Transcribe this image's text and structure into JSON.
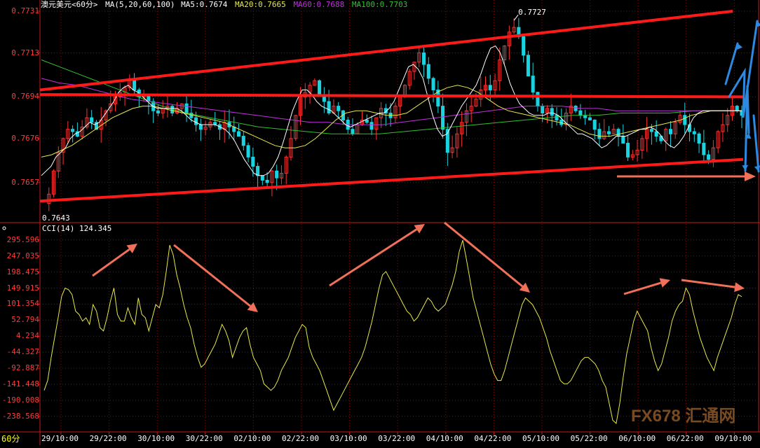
{
  "header": {
    "symbol": "澳元美元<60分>",
    "ma_label": "MA(5,20,60,100)",
    "ma5": "MA5:0.7674",
    "ma20": "MA20:0.7665",
    "ma60": "MA60:0.7688",
    "ma100": "MA100:0.7703"
  },
  "cci_header": "CCI(14) 124.345",
  "period_label": "60分",
  "watermark": "FX678 汇通网",
  "colors": {
    "background": "#000000",
    "axis_red": "#c41a1a",
    "candle_up": "#ff3030",
    "candle_down": "#19d3e0",
    "ma5": "#ffffff",
    "ma20": "#e8e84a",
    "ma60": "#c030e0",
    "ma100": "#30c030",
    "cci": "#e8e84a",
    "trend_lines": "#ff1a1a",
    "arrows": "#f0705a",
    "blue_arrows": "#2d8ae0"
  },
  "chart_data": [
    {
      "type": "candlestick",
      "title": "澳元美元<60分>",
      "y_ticks": [
        "0.7731",
        "0.7713",
        "0.7694",
        "0.7676",
        "0.7657"
      ],
      "ylim": [
        0.764,
        0.7731
      ],
      "x_ticks": [
        "29/10:00",
        "29/22:00",
        "30/10:00",
        "30/22:00",
        "02/10:00",
        "02/22:00",
        "03/10:00",
        "03/22:00",
        "04/10:00",
        "04/22:00",
        "05/10:00",
        "05/22:00",
        "06/10:00",
        "06/22:00",
        "09/10:00"
      ],
      "annotations": [
        "0.7727",
        "0.7643"
      ],
      "high_value": 0.7727,
      "low_value": 0.7643,
      "series": [
        {
          "name": "MA5",
          "value": 0.7674
        },
        {
          "name": "MA20",
          "value": 0.7665
        },
        {
          "name": "MA60",
          "value": 0.7688
        },
        {
          "name": "MA100",
          "value": 0.7703
        }
      ],
      "close_path": [
        0.7648,
        0.7652,
        0.7662,
        0.767,
        0.7676,
        0.768,
        0.7679,
        0.7677,
        0.7681,
        0.7685,
        0.7683,
        0.768,
        0.7684,
        0.7688,
        0.7691,
        0.7694,
        0.7696,
        0.7698,
        0.7701,
        0.7697,
        0.7694,
        0.7695,
        0.7692,
        0.7688,
        0.7687,
        0.7689,
        0.769,
        0.7687,
        0.7689,
        0.7691,
        0.7687,
        0.7685,
        0.7682,
        0.768,
        0.7681,
        0.7683,
        0.7682,
        0.768,
        0.7683,
        0.7681,
        0.7679,
        0.7677,
        0.7673,
        0.7668,
        0.7664,
        0.766,
        0.7658,
        0.7657,
        0.7662,
        0.7659,
        0.7661,
        0.7668,
        0.7676,
        0.7686,
        0.7694,
        0.7696,
        0.7699,
        0.7701,
        0.7695,
        0.7692,
        0.7687,
        0.769,
        0.7688,
        0.7684,
        0.768,
        0.7678,
        0.7682,
        0.7684,
        0.7683,
        0.768,
        0.7685,
        0.7689,
        0.7687,
        0.7685,
        0.769,
        0.7694,
        0.7699,
        0.7705,
        0.7709,
        0.7713,
        0.7708,
        0.7702,
        0.7697,
        0.769,
        0.768,
        0.767,
        0.7672,
        0.7678,
        0.7683,
        0.7688,
        0.769,
        0.7693,
        0.7697,
        0.7699,
        0.7697,
        0.7701,
        0.771,
        0.7716,
        0.7722,
        0.7724,
        0.772,
        0.7712,
        0.7703,
        0.7696,
        0.769,
        0.7687,
        0.7689,
        0.7686,
        0.7684,
        0.7682,
        0.7687,
        0.769,
        0.7688,
        0.7686,
        0.7685,
        0.7684,
        0.768,
        0.7676,
        0.7679,
        0.7678,
        0.768,
        0.7677,
        0.7674,
        0.7668,
        0.7669,
        0.7671,
        0.7676,
        0.768,
        0.7679,
        0.7677,
        0.7675,
        0.768,
        0.7678,
        0.7683,
        0.7686,
        0.7682,
        0.7679,
        0.7678,
        0.7674,
        0.7669,
        0.7667,
        0.7672,
        0.7679,
        0.7682,
        0.7686,
        0.769,
        0.7688,
        0.7686
      ],
      "ma5_path": [
        0.766,
        0.7662,
        0.7664,
        0.7668,
        0.767,
        0.7672,
        0.7676,
        0.7678,
        0.7679,
        0.7681,
        0.7683,
        0.7682,
        0.7683,
        0.7686,
        0.7689,
        0.7692,
        0.7696,
        0.7698,
        0.7699,
        0.7697,
        0.7696,
        0.7694,
        0.7692,
        0.769,
        0.7689,
        0.7689,
        0.7689,
        0.7689,
        0.7689,
        0.7688,
        0.7686,
        0.7684,
        0.7683,
        0.7682,
        0.7682,
        0.7682,
        0.7682,
        0.7681,
        0.768,
        0.7678,
        0.7675,
        0.7671,
        0.7667,
        0.7664,
        0.7661,
        0.766,
        0.766,
        0.7661,
        0.7664,
        0.7668,
        0.7674,
        0.7681,
        0.7688,
        0.7693,
        0.7697,
        0.7697,
        0.7695,
        0.7692,
        0.769,
        0.7689,
        0.7688,
        0.7686,
        0.7684,
        0.7682,
        0.7681,
        0.7682,
        0.7683,
        0.7684,
        0.7685,
        0.7686,
        0.7687,
        0.7687,
        0.7689,
        0.7692,
        0.7697,
        0.7702,
        0.7707,
        0.7708,
        0.7706,
        0.7702,
        0.7694,
        0.7686,
        0.768,
        0.7677,
        0.7678,
        0.7682,
        0.7686,
        0.769,
        0.7693,
        0.7696,
        0.7699,
        0.7704,
        0.771,
        0.7715,
        0.7716,
        0.7713,
        0.7707,
        0.77,
        0.7695,
        0.7691,
        0.7689,
        0.7687,
        0.7686,
        0.7686,
        0.7686,
        0.7687,
        0.7687,
        0.7686,
        0.7684,
        0.7682,
        0.768,
        0.7678,
        0.7678,
        0.7677,
        0.7676,
        0.7674,
        0.7672,
        0.7673,
        0.7675,
        0.7677,
        0.7677,
        0.7677,
        0.7678,
        0.7679,
        0.768,
        0.768,
        0.7681,
        0.768,
        0.7678,
        0.7675,
        0.7673,
        0.7672,
        0.7674,
        0.7677,
        0.7681,
        0.7685,
        0.7687,
        0.7688,
        0.7688,
        0.7688,
        0.7688,
        0.7688,
        0.7688,
        0.7688,
        0.7688,
        0.7688
      ],
      "ma20_path": [
        0.7668,
        0.7669,
        0.7671,
        0.7673,
        0.7676,
        0.7679,
        0.7682,
        0.7685,
        0.7687,
        0.7689,
        0.769,
        0.769,
        0.7689,
        0.7688,
        0.7687,
        0.7686,
        0.7685,
        0.7684,
        0.7683,
        0.7681,
        0.7679,
        0.7677,
        0.7675,
        0.7673,
        0.7672,
        0.7672,
        0.7673,
        0.7676,
        0.768,
        0.7684,
        0.7687,
        0.7688,
        0.7688,
        0.7687,
        0.7686,
        0.7686,
        0.7687,
        0.769,
        0.7693,
        0.7696,
        0.7698,
        0.7699,
        0.7698,
        0.7696,
        0.7693,
        0.769,
        0.7688,
        0.7687,
        0.7686,
        0.7685,
        0.7684,
        0.7683,
        0.7682,
        0.768,
        0.7678,
        0.7677,
        0.7677,
        0.7678,
        0.7679,
        0.768,
        0.7681,
        0.7682,
        0.7683,
        0.7684,
        0.7686,
        0.7687,
        0.7688,
        0.7688,
        0.7688,
        0.7688
      ],
      "ma60_path": [
        0.7702,
        0.77,
        0.7699,
        0.7697,
        0.7695,
        0.7693,
        0.7692,
        0.7691,
        0.769,
        0.7689,
        0.7688,
        0.7687,
        0.7686,
        0.7685,
        0.7684,
        0.7683,
        0.7683,
        0.7682,
        0.7682,
        0.7682,
        0.7683,
        0.7684,
        0.7685,
        0.7686,
        0.7687,
        0.7688,
        0.7689,
        0.769,
        0.769,
        0.769,
        0.7689,
        0.7689,
        0.7688,
        0.7688,
        0.7688,
        0.7688,
        0.7688,
        0.7688,
        0.7688,
        0.7688
      ],
      "ma100_path": [
        0.771,
        0.7706,
        0.7702,
        0.7698,
        0.7694,
        0.769,
        0.7687,
        0.7685,
        0.7683,
        0.7681,
        0.768,
        0.7679,
        0.7678,
        0.7678,
        0.7678,
        0.7679,
        0.768,
        0.7681,
        0.7682,
        0.7683,
        0.7684,
        0.7685,
        0.7686,
        0.7686,
        0.7687,
        0.7687,
        0.7687,
        0.7688,
        0.7688,
        0.7688
      ]
    },
    {
      "type": "line",
      "title": "CCI(14) 124.345",
      "current_value": 124.345,
      "y_ticks": [
        "295.596",
        "247.035",
        "198.475",
        "149.915",
        "101.354",
        "52.794",
        "4.234",
        "-44.327",
        "-92.887",
        "-141.448",
        "-190.008",
        "-238.568"
      ],
      "ylim": [
        -275,
        310
      ],
      "series": [
        {
          "name": "CCI(14)",
          "values": [
            -160,
            -130,
            -60,
            0,
            60,
            125,
            150,
            145,
            130,
            80,
            70,
            50,
            60,
            40,
            100,
            80,
            30,
            20,
            60,
            110,
            150,
            70,
            50,
            50,
            90,
            60,
            40,
            120,
            70,
            60,
            20,
            60,
            100,
            90,
            130,
            200,
            280,
            250,
            190,
            150,
            100,
            60,
            30,
            -20,
            -60,
            -90,
            -80,
            -60,
            -40,
            -20,
            10,
            40,
            20,
            -10,
            -60,
            -30,
            0,
            20,
            30,
            -20,
            -60,
            -80,
            -100,
            -140,
            -150,
            -160,
            -150,
            -130,
            -100,
            -80,
            -60,
            -30,
            0,
            20,
            40,
            30,
            -30,
            -60,
            -80,
            -100,
            -130,
            -160,
            -190,
            -220,
            -200,
            -180,
            -160,
            -140,
            -120,
            -100,
            -80,
            -60,
            -30,
            10,
            50,
            100,
            150,
            190,
            200,
            180,
            160,
            140,
            120,
            100,
            80,
            70,
            50,
            60,
            80,
            100,
            120,
            110,
            90,
            80,
            90,
            100,
            130,
            160,
            200,
            260,
            295,
            240,
            180,
            120,
            80,
            40,
            0,
            -40,
            -80,
            -110,
            -130,
            -130,
            -100,
            -60,
            -20,
            20,
            60,
            100,
            120,
            110,
            100,
            80,
            60,
            30,
            0,
            -40,
            -70,
            -100,
            -130,
            -140,
            -140,
            -130,
            -110,
            -90,
            -70,
            -60,
            -60,
            -70,
            -80,
            -100,
            -130,
            -150,
            -200,
            -250,
            -260,
            -200,
            -120,
            -50,
            0,
            50,
            80,
            60,
            40,
            20,
            -30,
            -70,
            -100,
            -80,
            -40,
            0,
            50,
            80,
            100,
            110,
            150,
            130,
            80,
            40,
            0,
            -30,
            -60,
            -80,
            -100,
            -60,
            -30,
            0,
            30,
            60,
            100,
            130,
            124
          ]
        }
      ]
    }
  ]
}
